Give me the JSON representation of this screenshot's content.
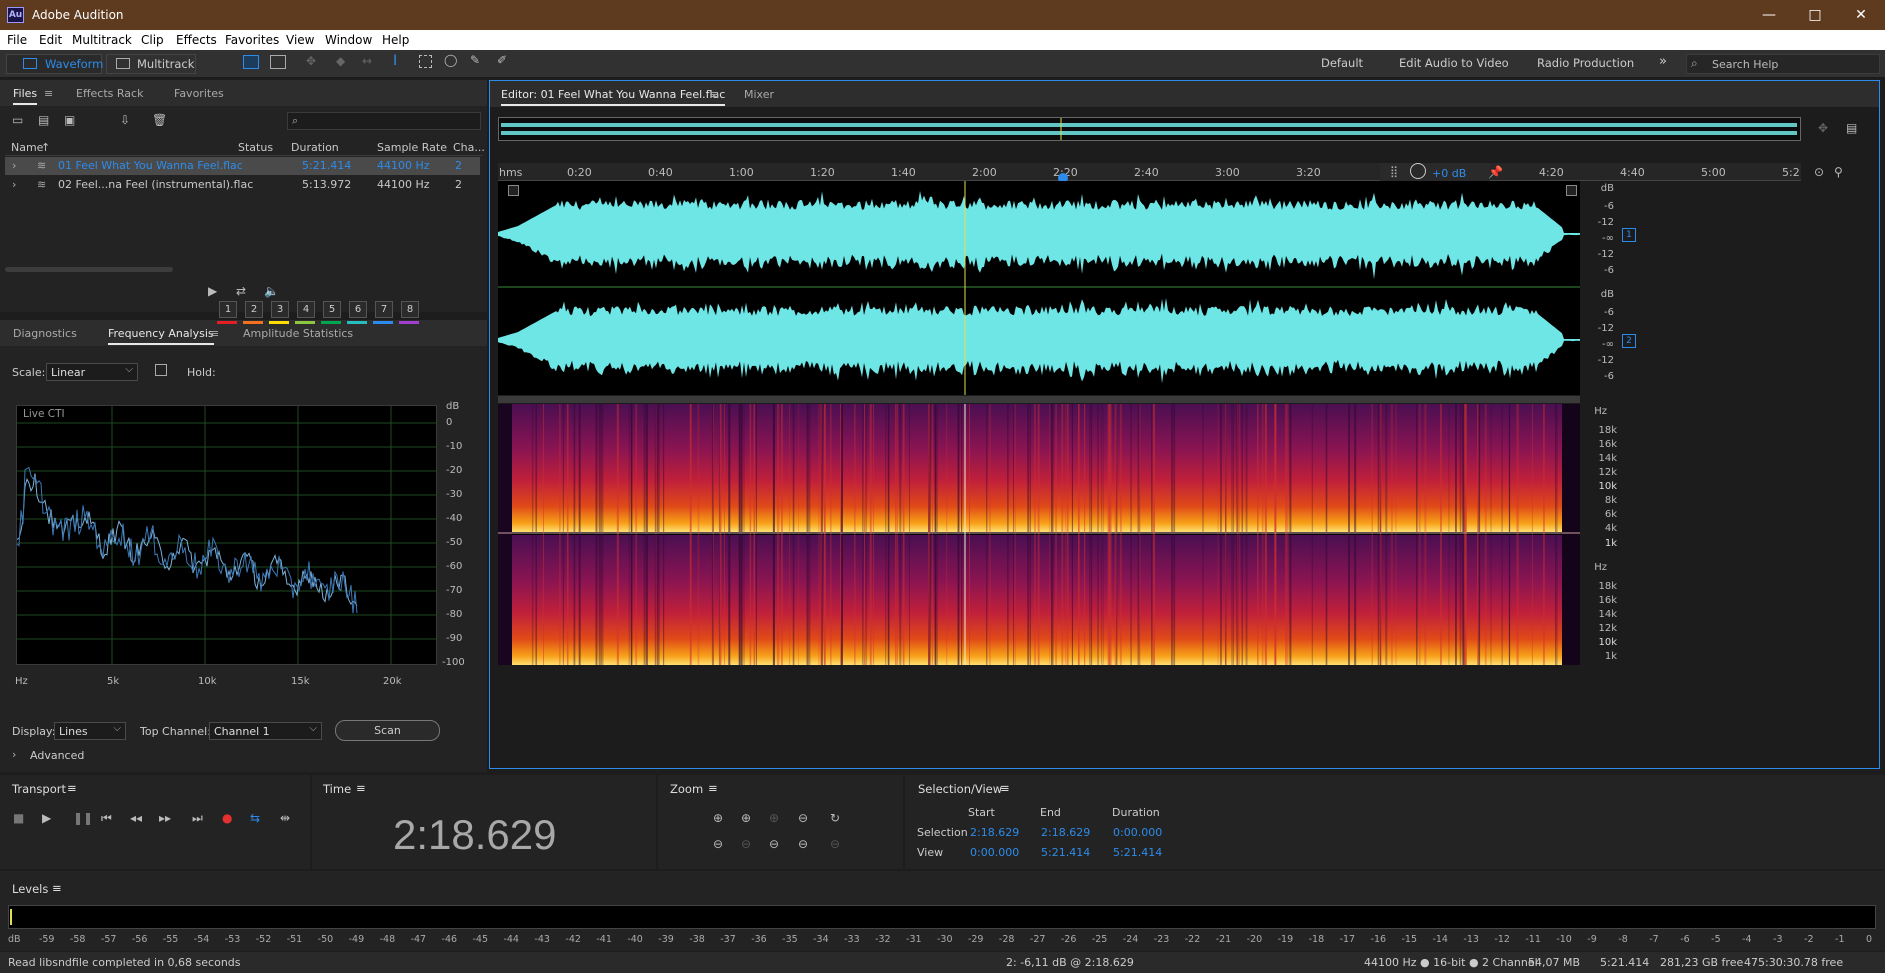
{
  "app": {
    "icon_text": "Au",
    "title": "Adobe Audition"
  },
  "menu": [
    "File",
    "Edit",
    "Multitrack",
    "Clip",
    "Effects",
    "Favorites",
    "View",
    "Window",
    "Help"
  ],
  "toolbar": {
    "waveform": "Waveform",
    "multitrack": "Multitrack",
    "workspaces": [
      "Default",
      "Edit Audio to Video",
      "Radio Production"
    ],
    "more": "»",
    "search_placeholder": "Search Help"
  },
  "files_panel": {
    "tabs": [
      "Files",
      "Effects Rack",
      "Favorites"
    ],
    "columns": [
      "Name",
      "Status",
      "Duration",
      "Sample Rate",
      "Cha..."
    ],
    "rows": [
      {
        "name": "01 Feel What You Wanna Feel.flac",
        "status": "",
        "duration": "5:21.414",
        "rate": "44100 Hz",
        "ch": "2",
        "selected": true
      },
      {
        "name": "02 Feel...na Feel (instrumental).flac",
        "status": "",
        "duration": "5:13.972",
        "rate": "44100 Hz",
        "ch": "2",
        "selected": false
      }
    ]
  },
  "analysis_panel": {
    "tabs": [
      "Diagnostics",
      "Frequency Analysis",
      "Amplitude Statistics"
    ],
    "scale_label": "Scale:",
    "scale_value": "Linear",
    "hold_label": "Hold:",
    "hold": [
      "1",
      "2",
      "3",
      "4",
      "5",
      "6",
      "7",
      "8"
    ],
    "hold_colors": [
      "#e21f26",
      "#f37021",
      "#ffdd00",
      "#8dc63f",
      "#00a651",
      "#27bdbe",
      "#2d8ceb",
      "#a23ecf"
    ],
    "live_label": "Live CTI",
    "db_unit": "dB",
    "db_ticks": [
      "0",
      "-10",
      "-20",
      "-30",
      "-40",
      "-50",
      "-60",
      "-70",
      "-80",
      "-90",
      "-100"
    ],
    "hz_ticks": [
      "Hz",
      "5k",
      "10k",
      "15k",
      "20k"
    ],
    "display_label": "Display:",
    "display_value": "Lines",
    "top_channel_label": "Top Channel:",
    "top_channel_value": "Channel 1",
    "scan": "Scan",
    "advanced": "Advanced"
  },
  "editor": {
    "tabs": [
      "Editor: 01 Feel What You Wanna Feel.flac",
      "Mixer"
    ],
    "ruler": [
      "hms",
      "0:20",
      "0:40",
      "1:00",
      "1:20",
      "1:40",
      "2:00",
      "2:20",
      "2:40",
      "3:00",
      "3:20",
      "4:20",
      "4:40",
      "5:00",
      "5:2"
    ],
    "gain": "+0 dB",
    "db_scale": [
      "dB",
      "-6",
      "-12",
      "-∞",
      "-12",
      "-6"
    ],
    "channels": [
      "1",
      "2"
    ],
    "hz_scale": [
      "Hz",
      "18k",
      "16k",
      "14k",
      "12k",
      "10k",
      "8k",
      "6k",
      "4k",
      "1k"
    ],
    "wave_color": "#6ee6e6",
    "playhead_color": "#e0e050"
  },
  "transport": {
    "title": "Transport"
  },
  "time": {
    "title": "Time",
    "value": "2:18.629"
  },
  "zoom": {
    "title": "Zoom"
  },
  "selection_view": {
    "title": "Selection/View",
    "headers": [
      "Start",
      "End",
      "Duration"
    ],
    "selection": {
      "label": "Selection",
      "start": "2:18.629",
      "end": "2:18.629",
      "duration": "0:00.000"
    },
    "view": {
      "label": "View",
      "start": "0:00.000",
      "end": "5:21.414",
      "duration": "5:21.414"
    }
  },
  "levels": {
    "title": "Levels",
    "ticks": [
      "dB",
      "-59",
      "-58",
      "-57",
      "-56",
      "-55",
      "-54",
      "-53",
      "-52",
      "-51",
      "-50",
      "-49",
      "-48",
      "-47",
      "-46",
      "-45",
      "-44",
      "-43",
      "-42",
      "-41",
      "-40",
      "-39",
      "-38",
      "-37",
      "-36",
      "-35",
      "-34",
      "-33",
      "-32",
      "-31",
      "-30",
      "-29",
      "-28",
      "-27",
      "-26",
      "-25",
      "-24",
      "-23",
      "-22",
      "-21",
      "-20",
      "-19",
      "-18",
      "-17",
      "-16",
      "-15",
      "-14",
      "-13",
      "-12",
      "-11",
      "-10",
      "-9",
      "-8",
      "-7",
      "-6",
      "-5",
      "-4",
      "-3",
      "-2",
      "-1",
      "0"
    ]
  },
  "status": {
    "left": "Read libsndfile completed in 0,68 seconds",
    "cursor": "2: -6,11 dB @ 2:18.629",
    "format": "44100 Hz ● 16-bit ● 2 Channel",
    "size": "54,07 MB",
    "duration": "5:21.414",
    "free": "281,23 GB free",
    "free_time": "475:30:30.78 free"
  }
}
